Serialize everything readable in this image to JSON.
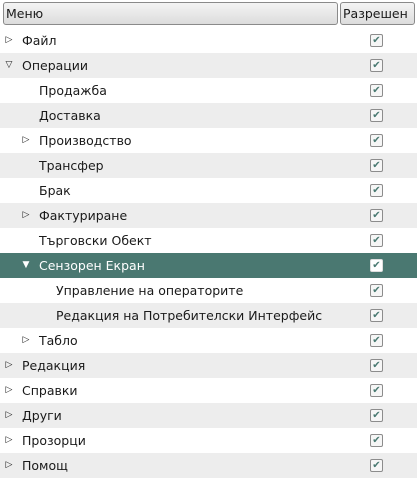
{
  "header": {
    "menu": "Меню",
    "allowed": "Разрешен"
  },
  "rows": [
    {
      "label": "Файл",
      "level": 0,
      "expander": "collapsed",
      "checked": true
    },
    {
      "label": "Операции",
      "level": 0,
      "expander": "expanded",
      "checked": true
    },
    {
      "label": "Продажба",
      "level": 1,
      "expander": "none",
      "checked": true
    },
    {
      "label": "Доставка",
      "level": 1,
      "expander": "none",
      "checked": true
    },
    {
      "label": "Производство",
      "level": 1,
      "expander": "collapsed",
      "checked": true
    },
    {
      "label": "Трансфер",
      "level": 1,
      "expander": "none",
      "checked": true
    },
    {
      "label": "Брак",
      "level": 1,
      "expander": "none",
      "checked": true
    },
    {
      "label": "Фактуриране",
      "level": 1,
      "expander": "collapsed",
      "checked": true
    },
    {
      "label": "Търговски Обект",
      "level": 1,
      "expander": "none",
      "checked": true
    },
    {
      "label": "Сензорен Екран",
      "level": 1,
      "expander": "expanded",
      "checked": true,
      "selected": true
    },
    {
      "label": "Управление на операторите",
      "level": 2,
      "expander": "none",
      "checked": true
    },
    {
      "label": "Редакция на Потребителски Интерфейс",
      "level": 2,
      "expander": "none",
      "checked": true
    },
    {
      "label": "Табло",
      "level": 1,
      "expander": "collapsed",
      "checked": true
    },
    {
      "label": "Редакция",
      "level": 0,
      "expander": "collapsed",
      "checked": true
    },
    {
      "label": "Справки",
      "level": 0,
      "expander": "collapsed",
      "checked": true
    },
    {
      "label": "Други",
      "level": 0,
      "expander": "collapsed",
      "checked": true
    },
    {
      "label": "Прозорци",
      "level": 0,
      "expander": "collapsed",
      "checked": true
    },
    {
      "label": "Помощ",
      "level": 0,
      "expander": "collapsed",
      "checked": true
    }
  ],
  "colors": {
    "selected": "#4a7871",
    "alt_row": "#ededed"
  }
}
